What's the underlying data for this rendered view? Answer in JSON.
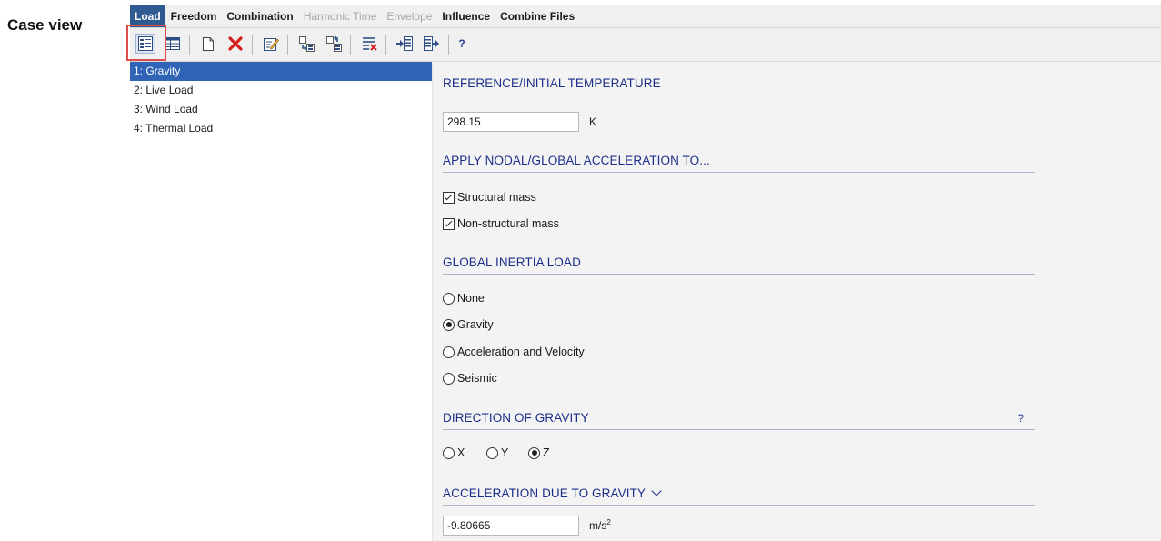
{
  "caption": "Case view",
  "tabs": [
    {
      "label": "Load",
      "state": "active"
    },
    {
      "label": "Freedom",
      "state": "normal"
    },
    {
      "label": "Combination",
      "state": "normal"
    },
    {
      "label": "Harmonic Time",
      "state": "disabled"
    },
    {
      "label": "Envelope",
      "state": "disabled"
    },
    {
      "label": "Influence",
      "state": "normal"
    },
    {
      "label": "Combine Files",
      "state": "normal"
    }
  ],
  "toolbar": {
    "help_label": "?",
    "icons": [
      "case-view-icon",
      "table-view-icon",
      "new-document-icon",
      "delete-icon",
      "edit-icon",
      "copy-case-icon",
      "paste-case-icon",
      "clear-icon",
      "import-icon",
      "export-icon",
      "help-icon"
    ]
  },
  "cases": [
    "1: Gravity",
    "2: Live Load",
    "3: Wind Load",
    "4: Thermal Load"
  ],
  "selected_case": "1: Gravity",
  "reference_temperature": {
    "title": "REFERENCE/INITIAL TEMPERATURE",
    "value": "298.15",
    "unit": "K"
  },
  "acceleration_apply": {
    "title": "APPLY NODAL/GLOBAL ACCELERATION TO...",
    "options": [
      {
        "label": "Structural mass",
        "checked": true
      },
      {
        "label": "Non-structural mass",
        "checked": true
      }
    ]
  },
  "global_inertia": {
    "title": "GLOBAL INERTIA LOAD",
    "options": [
      "None",
      "Gravity",
      "Acceleration and Velocity",
      "Seismic"
    ],
    "selected": "Gravity"
  },
  "gravity_direction": {
    "title": "DIRECTION OF GRAVITY",
    "help": "?",
    "options": [
      "X",
      "Y",
      "Z"
    ],
    "selected": "Z"
  },
  "gravity_acceleration": {
    "title": "ACCELERATION DUE TO GRAVITY",
    "value": "-9.80665",
    "unit": "m/s",
    "unit_exponent": "2"
  },
  "colors": {
    "active_tab": "#2f5b92",
    "selected_row": "#2f64b6",
    "section_title": "#1c2f8a",
    "highlight_box": "#e04b4b"
  }
}
